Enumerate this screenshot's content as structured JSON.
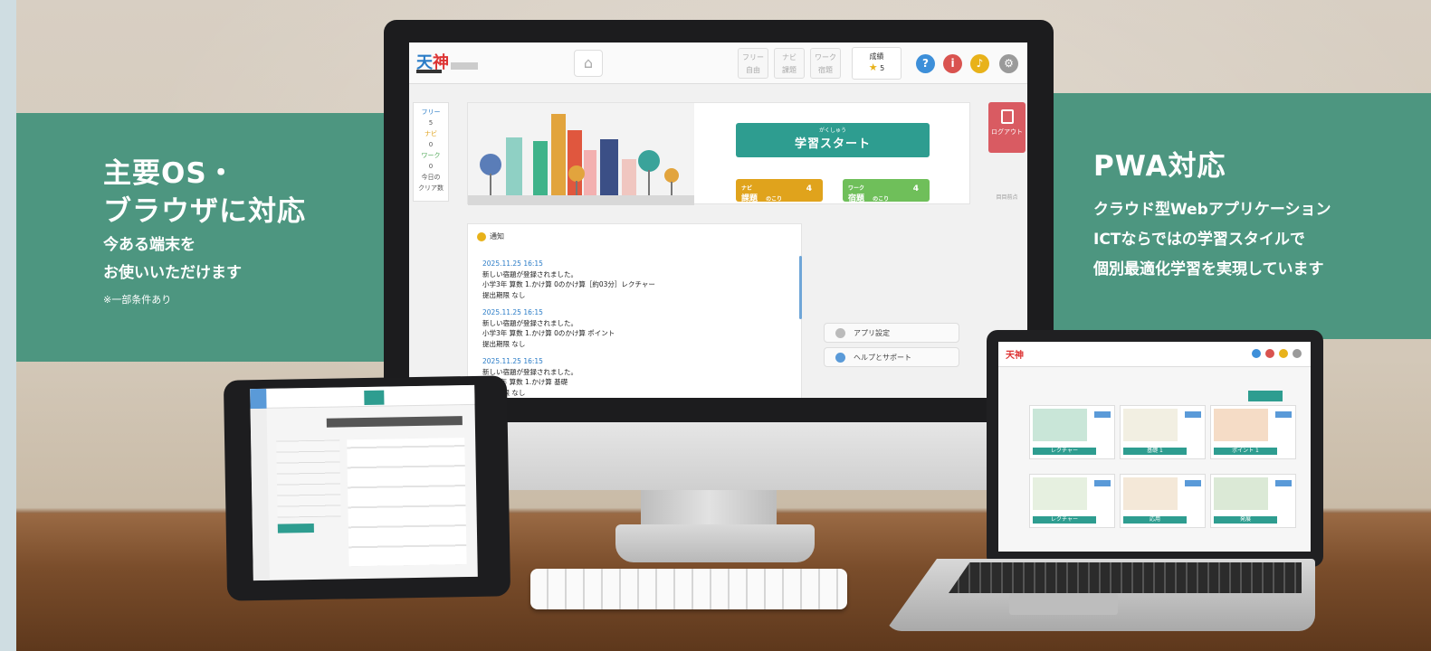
{
  "banner_left": {
    "line1": "主要OS・",
    "line2": "ブラウザに対応",
    "line3": "今ある端末を",
    "line4": "お使いいただけます",
    "note": "※一部条件あり"
  },
  "banner_right": {
    "title": "PWA対応",
    "line1": "クラウド型Webアプリケーション",
    "line2": "ICTならではの学習スタイルで",
    "line3": "個別最適化学習を実現しています"
  },
  "app": {
    "logo_a": "天",
    "logo_b": "神",
    "modes": [
      {
        "top": "フリー",
        "bottom": "自由"
      },
      {
        "top": "ナビ",
        "bottom": "課題"
      },
      {
        "top": "ワーク",
        "bottom": "宿題"
      }
    ],
    "score": {
      "label": "成績",
      "value": "5"
    },
    "icons": {
      "help": "?",
      "info": "i"
    },
    "colors": {
      "help": "#3d8fd9",
      "info": "#d9534f",
      "bell": "#e8b21a",
      "gear": "#9a9a9a",
      "teal": "#2e9d90"
    },
    "side_stats": [
      {
        "label": "フリー",
        "value": "5"
      },
      {
        "label": "ナビ",
        "value": "0"
      },
      {
        "label": "ワーク",
        "value": "0"
      }
    ],
    "side_footer_1": "今日の",
    "side_footer_2": "クリア数",
    "start_ruby": "がくしゅう",
    "start_label": "学習スタート",
    "chip_navi": {
      "tag": "ナビ",
      "name": "課題",
      "sub": "のこり",
      "count": "4"
    },
    "chip_work": {
      "tag": "ワーク",
      "name": "宿題",
      "sub": "のこり",
      "count": "4"
    },
    "logout_label": "ログアウト",
    "side_note": "目目前点",
    "notice_title": "通知",
    "notices": [
      {
        "date": "2025.11.25 16:15",
        "line1": "新しい宿題が登録されました。",
        "line2": "小学3年 算数 1.かけ算 0のかけ算［約03分］レクチャー",
        "line3": "提出期限 なし"
      },
      {
        "date": "2025.11.25 16:15",
        "line1": "新しい宿題が登録されました。",
        "line2": "小学3年 算数 1.かけ算 0のかけ算 ポイント",
        "line3": "提出期限 なし"
      },
      {
        "date": "2025.11.25 16:15",
        "line1": "新しい宿題が登録されました。",
        "line2": "小学3年 算数 1.かけ算 基礎",
        "line3": "提出期限 なし"
      }
    ],
    "menu_settings": "アプリ設定",
    "menu_help": "ヘルプとサポート"
  },
  "laptop": {
    "cards": [
      "レクチャー",
      "基礎 1",
      "ポイント 1",
      "レクチャー",
      "応用",
      "発展"
    ]
  }
}
